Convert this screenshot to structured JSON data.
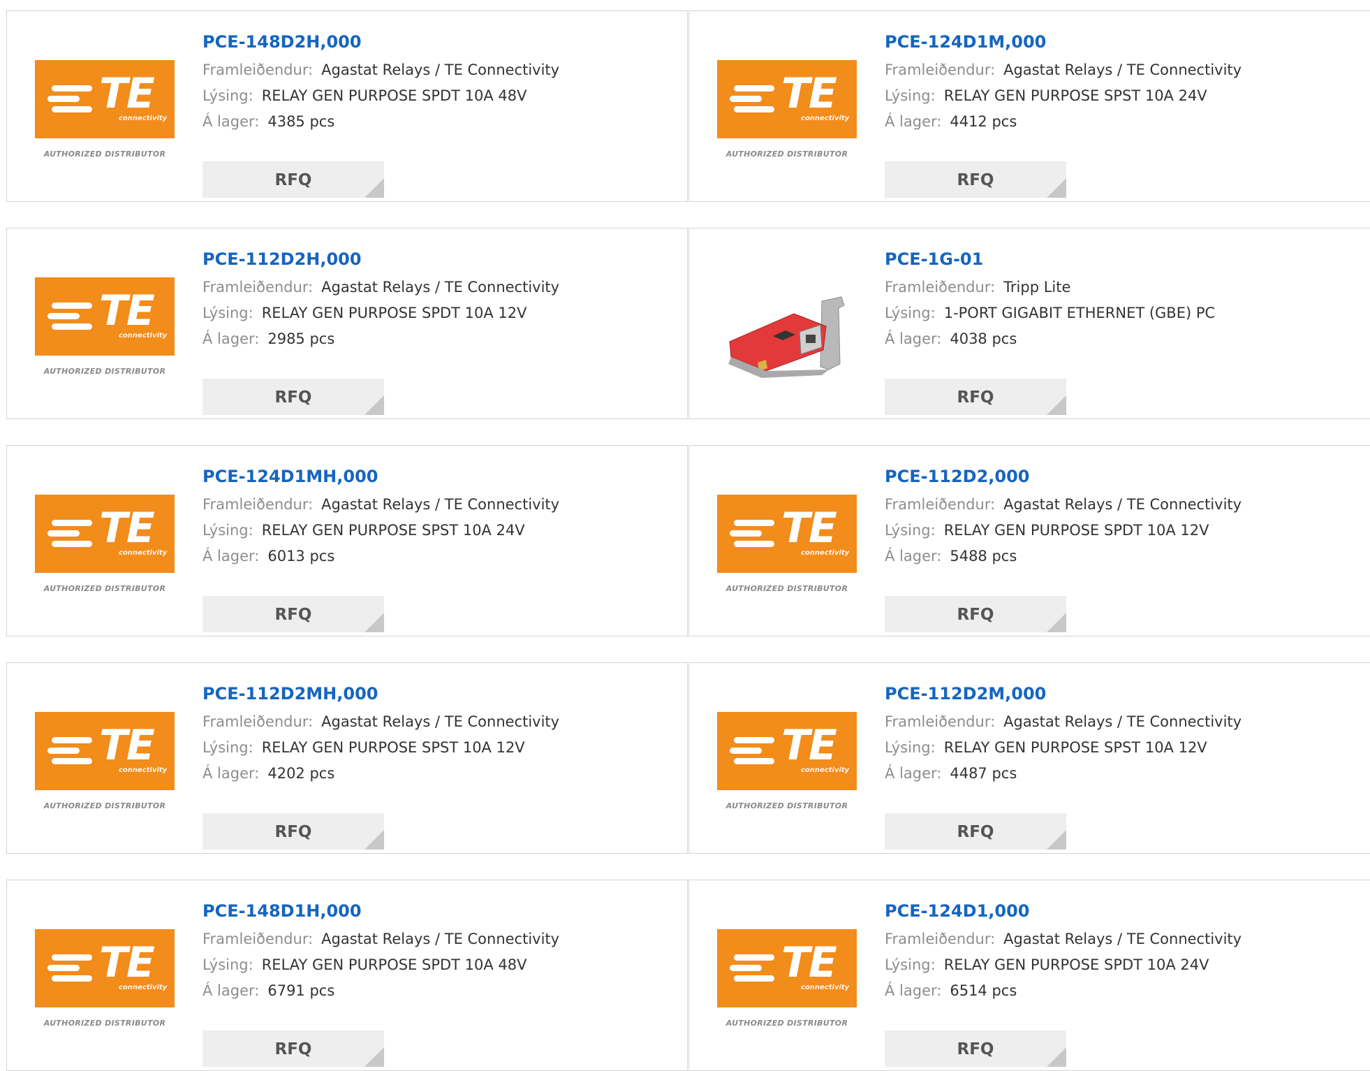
{
  "labels": {
    "manufacturer": "Framleiðendur:",
    "description": "Lýsing:",
    "stock": "Á lager:",
    "rfq": "RFQ"
  },
  "logo": {
    "te_word": "TE",
    "te_sub": "connectivity",
    "authorized": "AUTHORIZED DISTRIBUTOR",
    "brand_color": "#f28c1b"
  },
  "link_color": "#1565c0",
  "products": [
    {
      "part": "PCE-148D2H,000",
      "manufacturer": "Agastat Relays / TE Connectivity",
      "description": "RELAY GEN PURPOSE SPDT 10A 48V",
      "stock": "4385 pcs",
      "image": "te-logo"
    },
    {
      "part": "PCE-124D1M,000",
      "manufacturer": "Agastat Relays / TE Connectivity",
      "description": "RELAY GEN PURPOSE SPST 10A 24V",
      "stock": "4412 pcs",
      "image": "te-logo"
    },
    {
      "part": "PCE-112D2H,000",
      "manufacturer": "Agastat Relays / TE Connectivity",
      "description": "RELAY GEN PURPOSE SPDT 10A 12V",
      "stock": "2985 pcs",
      "image": "te-logo"
    },
    {
      "part": "PCE-1G-01",
      "manufacturer": "Tripp Lite",
      "description": "1-PORT GIGABIT ETHERNET (GBE) PC",
      "stock": "4038 pcs",
      "image": "pcie-card"
    },
    {
      "part": "PCE-124D1MH,000",
      "manufacturer": "Agastat Relays / TE Connectivity",
      "description": "RELAY GEN PURPOSE SPST 10A 24V",
      "stock": "6013 pcs",
      "image": "te-logo"
    },
    {
      "part": "PCE-112D2,000",
      "manufacturer": "Agastat Relays / TE Connectivity",
      "description": "RELAY GEN PURPOSE SPDT 10A 12V",
      "stock": "5488 pcs",
      "image": "te-logo"
    },
    {
      "part": "PCE-112D2MH,000",
      "manufacturer": "Agastat Relays / TE Connectivity",
      "description": "RELAY GEN PURPOSE SPST 10A 12V",
      "stock": "4202 pcs",
      "image": "te-logo"
    },
    {
      "part": "PCE-112D2M,000",
      "manufacturer": "Agastat Relays / TE Connectivity",
      "description": "RELAY GEN PURPOSE SPST 10A 12V",
      "stock": "4487 pcs",
      "image": "te-logo"
    },
    {
      "part": "PCE-148D1H,000",
      "manufacturer": "Agastat Relays / TE Connectivity",
      "description": "RELAY GEN PURPOSE SPDT 10A 48V",
      "stock": "6791 pcs",
      "image": "te-logo"
    },
    {
      "part": "PCE-124D1,000",
      "manufacturer": "Agastat Relays / TE Connectivity",
      "description": "RELAY GEN PURPOSE SPDT 10A 24V",
      "stock": "6514 pcs",
      "image": "te-logo"
    }
  ]
}
